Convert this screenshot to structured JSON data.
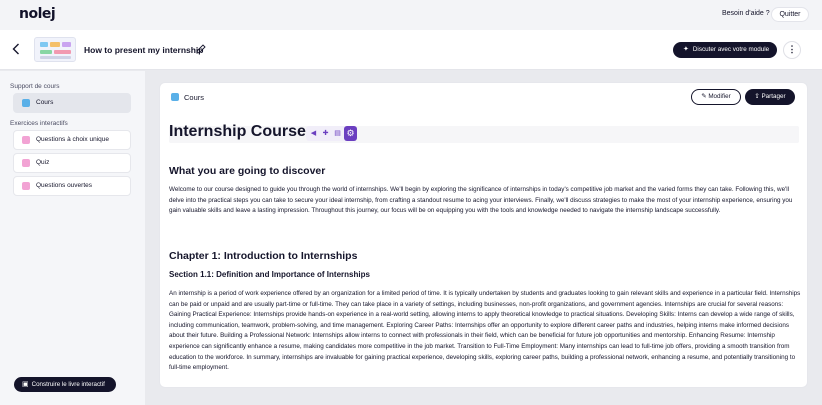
{
  "topbar": {
    "logo": "nolej",
    "help": "Besoin d'aide ?",
    "quit": "Quitter"
  },
  "header": {
    "back_icon": "chevron-left-icon",
    "title": "How to present my internship",
    "edit_icon": "pencil-icon",
    "discuss_label": "Discuter avec votre module",
    "discuss_icon": "sparkles-icon",
    "menu_icon": "more-vertical-icon"
  },
  "sidebar": {
    "section_course": "Support de cours",
    "course_item": "Cours",
    "section_exercises": "Exercices interactifs",
    "exercises": [
      {
        "label": "Questions à choix unique",
        "color": "#f2a3d4"
      },
      {
        "label": "Quiz",
        "color": "#f2a3d4"
      },
      {
        "label": "Questions ouvertes",
        "color": "#f2a3d4"
      }
    ],
    "build_label": "Construire le livre interactif",
    "build_icon": "book-icon"
  },
  "card": {
    "label": "Cours",
    "edit_label": "Modifier",
    "share_label": "Partager",
    "edit_icon": "pencil-icon",
    "share_icon": "share-icon"
  },
  "content": {
    "h1": "Internship Course",
    "tool_icons": [
      "audio-icon",
      "puzzle-icon",
      "flashcards-icon",
      "settings-icon"
    ],
    "discover_heading": "What you are going to discover",
    "discover_text": "Welcome to our course designed to guide you through the world of internships. We'll begin by exploring the significance of internships in today's competitive job market and the varied forms they can take. Following this, we'll delve into the practical steps you can take to secure your ideal internship, from crafting a standout resume to acing your interviews. Finally, we'll discuss strategies to make the most of your internship experience, ensuring you gain valuable skills and leave a lasting impression. Throughout this journey, our focus will be on equipping you with the tools and knowledge needed to navigate the internship landscape successfully.",
    "chapter_heading": "Chapter 1: Introduction to Internships",
    "section_heading": "Section 1.1: Definition and Importance of Internships",
    "section_text": "An internship is a period of work experience offered by an organization for a limited period of time. It is typically undertaken by students and graduates looking to gain relevant skills and experience in a particular field. Internships can be paid or unpaid and are usually part-time or full-time. They can take place in a variety of settings, including businesses, non-profit organizations, and government agencies. Internships are crucial for several reasons: Gaining Practical Experience: Internships provide hands-on experience in a real-world setting, allowing interns to apply theoretical knowledge to practical situations. Developing Skills: Interns can develop a wide range of skills, including communication, teamwork, problem-solving, and time management. Exploring Career Paths: Internships offer an opportunity to explore different career paths and industries, helping interns make informed decisions about their future. Building a Professional Network: Internships allow interns to connect with professionals in their field, which can be beneficial for future job opportunities and mentorship. Enhancing Resume: Internship experience can significantly enhance a resume, making candidates more competitive in the job market. Transition to Full-Time Employment: Many internships can lead to full-time job offers, providing a smooth transition from education to the workforce. In summary, internships are invaluable for gaining practical experience, developing skills, exploring career paths, building a professional network, enhancing a resume, and potentially transitioning to full-time employment."
  },
  "colors": {
    "dark": "#14142b",
    "accent_purple": "#6b3fc0",
    "course_blue": "#5ab0e8",
    "exercise_pink": "#f2a3d4"
  }
}
